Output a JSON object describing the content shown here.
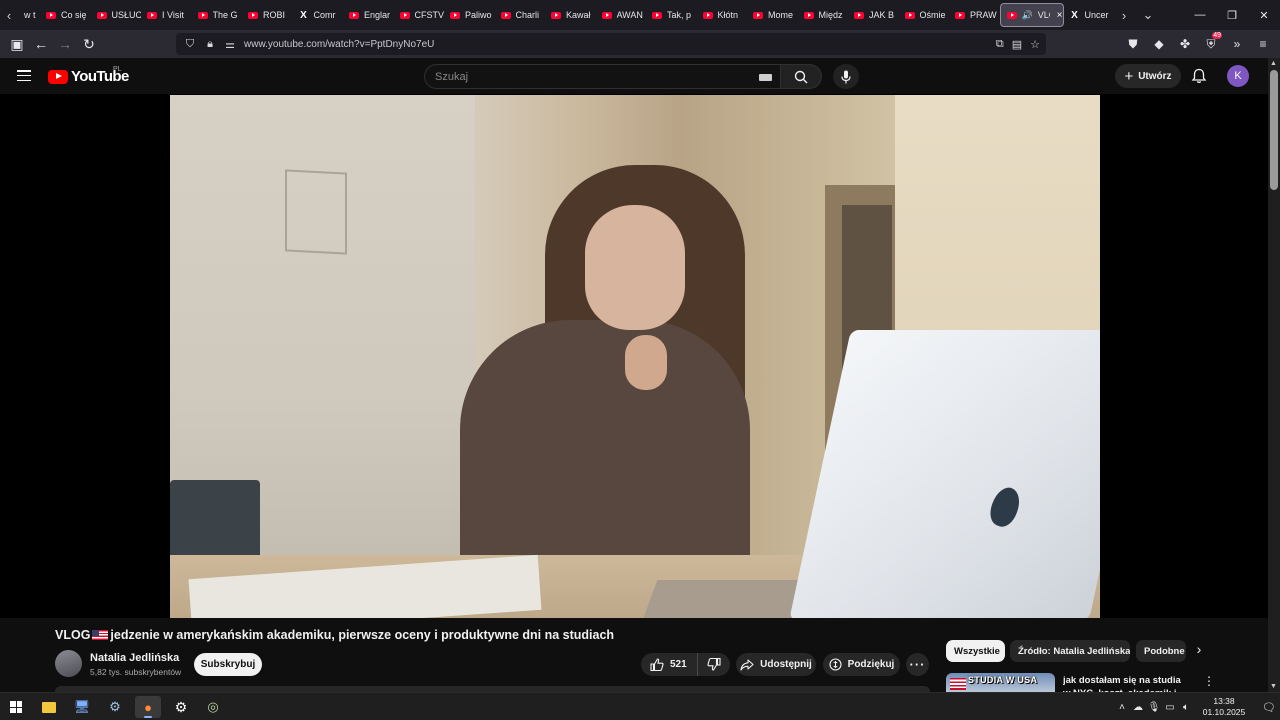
{
  "browser": {
    "tabs": [
      {
        "label": "w t",
        "favicon": "none"
      },
      {
        "label": "Co się",
        "favicon": "youtube-icon"
      },
      {
        "label": "USŁUC",
        "favicon": "youtube-icon"
      },
      {
        "label": "I Visit",
        "favicon": "youtube-icon"
      },
      {
        "label": "The G",
        "favicon": "youtube-icon"
      },
      {
        "label": "ROBI",
        "favicon": "youtube-icon"
      },
      {
        "label": "Comr",
        "favicon": "x-icon"
      },
      {
        "label": "Englar",
        "favicon": "youtube-icon"
      },
      {
        "label": "CFSTV",
        "favicon": "youtube-icon"
      },
      {
        "label": "Paliwo",
        "favicon": "youtube-icon"
      },
      {
        "label": "Charli",
        "favicon": "youtube-icon"
      },
      {
        "label": "Kawał",
        "favicon": "youtube-icon"
      },
      {
        "label": "AWAN",
        "favicon": "youtube-icon"
      },
      {
        "label": "Tak, p",
        "favicon": "youtube-icon"
      },
      {
        "label": "Kłótn",
        "favicon": "youtube-icon"
      },
      {
        "label": "Mome",
        "favicon": "youtube-icon"
      },
      {
        "label": "Międz",
        "favicon": "youtube-icon"
      },
      {
        "label": "JAK B",
        "favicon": "youtube-icon"
      },
      {
        "label": "Ośmie",
        "favicon": "youtube-icon"
      },
      {
        "label": "PRAW",
        "favicon": "youtube-icon"
      }
    ],
    "active_tab": {
      "label": "VLG"
    },
    "last_tab": {
      "label": "Uncer",
      "favicon": "x-icon"
    },
    "url": "www.youtube.com/watch?v=PptDnyNo7eU",
    "extension_badge": "49"
  },
  "youtube": {
    "logo_text": "YouTube",
    "region": "PL",
    "search_placeholder": "Szukaj",
    "create_label": "Utwórz",
    "avatar_letter": "K"
  },
  "video": {
    "title_prefix": "VLOG",
    "title_rest": " jedzenie w amerykańskim akademiku, pierwsze oceny i produktywne dni na studiach",
    "channel_name": "Natalia Jedlińska",
    "subscribers": "5,82 tys. subskrybentów",
    "subscribe_label": "Subskrybuj",
    "likes": "521",
    "share_label": "Udostępnij",
    "thanks_label": "Podziękuj",
    "more_label": "···"
  },
  "chips": [
    {
      "label": "Wszystkie",
      "active": true
    },
    {
      "label": "Źródło: Natalia Jedlińska",
      "active": false
    },
    {
      "label": "Podobne",
      "active": false
    }
  ],
  "recommendation": {
    "thumb_text": "STUDIA W USA",
    "title": "jak dostałam się na studia w NYC, koszt, akademik i wiele"
  },
  "taskbar": {
    "time": "13:38",
    "date": "01.10.2025"
  },
  "colors": {
    "yt_red": "#ff0000",
    "background": "#0f0f0f",
    "chip_bg": "#272727",
    "avatar_bg": "#7e57c2"
  }
}
